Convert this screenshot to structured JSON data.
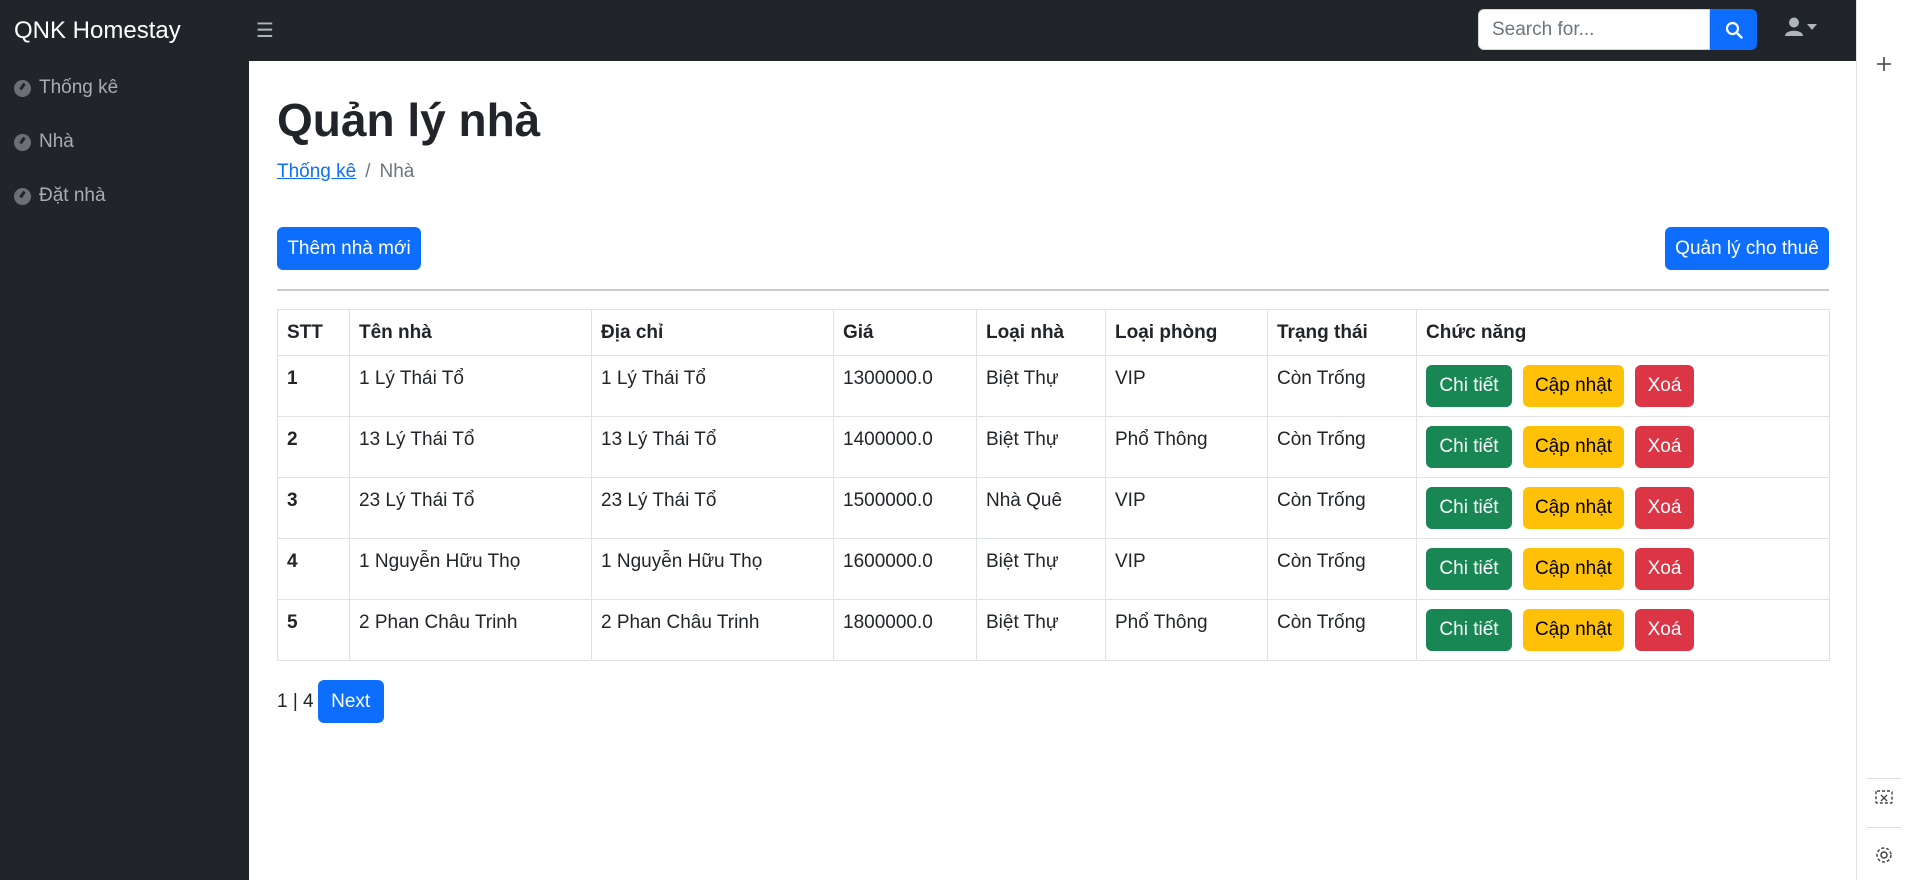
{
  "brand": "QNK Homestay",
  "search": {
    "placeholder": "Search for..."
  },
  "sidebar": {
    "items": [
      {
        "label": "Thống kê"
      },
      {
        "label": "Nhà"
      },
      {
        "label": "Đặt nhà"
      }
    ]
  },
  "page": {
    "title": "Quản lý nhà",
    "breadcrumb": {
      "home": "Thống kê",
      "separator": "/",
      "current": "Nhà"
    },
    "add_button": "Thêm nhà mới",
    "rent_button": "Quản lý cho thuê"
  },
  "table": {
    "headers": [
      "STT",
      "Tên nhà",
      "Địa chỉ",
      "Giá",
      "Loại nhà",
      "Loại phòng",
      "Trạng thái",
      "Chức năng"
    ],
    "rows": [
      {
        "stt": "1",
        "name": "1 Lý Thái Tổ",
        "address": "1 Lý Thái Tổ",
        "price": "1300000.0",
        "house_type": "Biệt Thự",
        "room_type": "VIP",
        "status": "Còn Trống"
      },
      {
        "stt": "2",
        "name": "13 Lý Thái Tổ",
        "address": "13 Lý Thái Tổ",
        "price": "1400000.0",
        "house_type": "Biệt Thự",
        "room_type": "Phổ Thông",
        "status": "Còn Trống"
      },
      {
        "stt": "3",
        "name": "23 Lý Thái Tổ",
        "address": "23 Lý Thái Tổ",
        "price": "1500000.0",
        "house_type": "Nhà Quê",
        "room_type": "VIP",
        "status": "Còn Trống"
      },
      {
        "stt": "4",
        "name": "1 Nguyễn Hữu Thọ",
        "address": "1 Nguyễn Hữu Thọ",
        "price": "1600000.0",
        "house_type": "Biệt Thự",
        "room_type": "VIP",
        "status": "Còn Trống"
      },
      {
        "stt": "5",
        "name": "2 Phan Châu Trinh",
        "address": "2 Phan Châu Trinh",
        "price": "1800000.0",
        "house_type": "Biệt Thự",
        "room_type": "Phổ Thông",
        "status": "Còn Trống"
      }
    ],
    "actions": {
      "detail": "Chi tiết",
      "update": "Cập nhật",
      "delete": "Xoá"
    }
  },
  "pagination": {
    "info": "1 | 4",
    "next_label": "Next"
  },
  "colors": {
    "primary": "#0d6efd",
    "success": "#198754",
    "warning": "#ffc107",
    "danger": "#dc3545",
    "dark": "#212529"
  },
  "icons": [
    "menu-icon",
    "search-icon",
    "user-icon",
    "caret-down-icon",
    "dashboard-icon",
    "plus-icon",
    "screenshot-icon",
    "gear-icon"
  ]
}
